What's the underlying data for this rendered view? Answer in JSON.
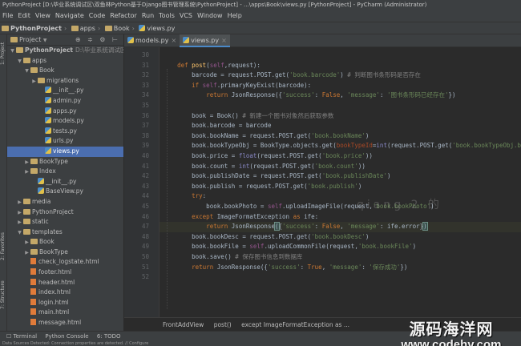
{
  "window": {
    "title": "PythonProject [D:\\毕业系统调试区\\双鱼林Python基于Django图书管理系统\\PythonProject] - ...\\apps\\Book\\views.py [PythonProject] - PyCharm (Administrator)"
  },
  "menu": [
    "File",
    "Edit",
    "View",
    "Navigate",
    "Code",
    "Refactor",
    "Run",
    "Tools",
    "VCS",
    "Window",
    "Help"
  ],
  "breadcrumb": [
    "PythonProject",
    "apps",
    "Book",
    "views.py"
  ],
  "project_panel": {
    "title": "Project",
    "tools": "⊕ ≑ ⚙ ⊢",
    "tree": [
      {
        "label": "PythonProject",
        "extra": "D:\\毕业系统调试区\\",
        "indent": 0,
        "arrow": "▼",
        "icon": "folder",
        "bold": true
      },
      {
        "label": "apps",
        "indent": 1,
        "arrow": "▼",
        "icon": "folder"
      },
      {
        "label": "Book",
        "indent": 2,
        "arrow": "▼",
        "icon": "folder"
      },
      {
        "label": "migrations",
        "indent": 3,
        "arrow": "▶",
        "icon": "folder"
      },
      {
        "label": "__init__.py",
        "indent": 4,
        "arrow": "",
        "icon": "py"
      },
      {
        "label": "admin.py",
        "indent": 4,
        "arrow": "",
        "icon": "py"
      },
      {
        "label": "apps.py",
        "indent": 4,
        "arrow": "",
        "icon": "py"
      },
      {
        "label": "models.py",
        "indent": 4,
        "arrow": "",
        "icon": "py"
      },
      {
        "label": "tests.py",
        "indent": 4,
        "arrow": "",
        "icon": "py"
      },
      {
        "label": "urls.py",
        "indent": 4,
        "arrow": "",
        "icon": "py"
      },
      {
        "label": "views.py",
        "indent": 4,
        "arrow": "",
        "icon": "py",
        "selected": true
      },
      {
        "label": "BookType",
        "indent": 2,
        "arrow": "▶",
        "icon": "folder"
      },
      {
        "label": "Index",
        "indent": 2,
        "arrow": "▶",
        "icon": "folder"
      },
      {
        "label": "__init__.py",
        "indent": 3,
        "arrow": "",
        "icon": "py"
      },
      {
        "label": "BaseView.py",
        "indent": 3,
        "arrow": "",
        "icon": "py"
      },
      {
        "label": "media",
        "indent": 1,
        "arrow": "▶",
        "icon": "folder"
      },
      {
        "label": "PythonProject",
        "indent": 1,
        "arrow": "▶",
        "icon": "folder"
      },
      {
        "label": "static",
        "indent": 1,
        "arrow": "▶",
        "icon": "folder"
      },
      {
        "label": "templates",
        "indent": 1,
        "arrow": "▼",
        "icon": "folder"
      },
      {
        "label": "Book",
        "indent": 2,
        "arrow": "▶",
        "icon": "folder"
      },
      {
        "label": "BookType",
        "indent": 2,
        "arrow": "▶",
        "icon": "folder"
      },
      {
        "label": "check_logstate.html",
        "indent": 2,
        "arrow": "",
        "icon": "html"
      },
      {
        "label": "footer.html",
        "indent": 2,
        "arrow": "",
        "icon": "html"
      },
      {
        "label": "header.html",
        "indent": 2,
        "arrow": "",
        "icon": "html"
      },
      {
        "label": "index.html",
        "indent": 2,
        "arrow": "",
        "icon": "html"
      },
      {
        "label": "login.html",
        "indent": 2,
        "arrow": "",
        "icon": "html"
      },
      {
        "label": "main.html",
        "indent": 2,
        "arrow": "",
        "icon": "html"
      },
      {
        "label": "message.html",
        "indent": 2,
        "arrow": "",
        "icon": "html"
      }
    ]
  },
  "side_tabs": {
    "project": "1: Project",
    "favorites": "2: Favorites",
    "structure": "7: Structure"
  },
  "tabs": [
    {
      "label": "models.py",
      "active": false
    },
    {
      "label": "views.py",
      "active": true
    }
  ],
  "code_lines": [
    {
      "n": "30",
      "html": ""
    },
    {
      "n": "31",
      "html": "    <span class=\"kw\">def</span> <span class=\"fn\">post</span>(<span class=\"sf\">self</span>,request):"
    },
    {
      "n": "32",
      "html": "        barcode = request.POST.get(<span class=\"st\">'book.barcode'</span>)<span class=\"cm\"> # 判断图书条形码是否存在</span>"
    },
    {
      "n": "33",
      "html": "        <span class=\"kw\">if</span> <span class=\"sf\">self</span>.primaryKeyExist(barcode):"
    },
    {
      "n": "34",
      "html": "            <span class=\"kw\">return</span> JsonResponse({<span class=\"st\">'success'</span>: <span class=\"kw\">False</span>, <span class=\"st\">'message'</span>: <span class=\"st\">'图书条形码已经存在'</span>})"
    },
    {
      "n": "35",
      "html": ""
    },
    {
      "n": "36",
      "html": "        book = Book()<span class=\"cm\"> # 新建一个图书对象然后获取参数</span>"
    },
    {
      "n": "37",
      "html": "        book.barcode = barcode"
    },
    {
      "n": "38",
      "html": "        book.bookName = request.POST.get(<span class=\"st\">'book.bookName'</span>)"
    },
    {
      "n": "39",
      "html": "        book.bookTypeObj = BookType.objects.get(<span class=\"pr\">bookTypeId</span>=<span class=\"bi\">int</span>(request.POST.get(<span class=\"st\">'book.bookTypeObj.bookTypeId'</span>)))"
    },
    {
      "n": "40",
      "html": "        book.price = <span class=\"bi\">float</span>(request.POST.get(<span class=\"st\">'book.price'</span>))"
    },
    {
      "n": "41",
      "html": "        book.count = <span class=\"bi\">int</span>(request.POST.get(<span class=\"st\">'book.count'</span>))"
    },
    {
      "n": "42",
      "html": "        book.publishDate = request.POST.get(<span class=\"st\">'book.publishDate'</span>)"
    },
    {
      "n": "43",
      "html": "        book.publish = request.POST.get(<span class=\"st\">'book.publish'</span>)"
    },
    {
      "n": "44",
      "html": "        <span class=\"kw\">try</span>:"
    },
    {
      "n": "45",
      "html": "            book.bookPhoto = <span class=\"sf\">self</span>.uploadImageFile(request,<span class=\"st\">'book.bookPhoto'</span>)"
    },
    {
      "n": "46",
      "html": "        <span class=\"kw\">except</span> ImageFormatException <span class=\"kw\">as</span> ife:"
    },
    {
      "n": "47",
      "html": "            <span class=\"kw\">return</span> JsonResponse<span class=\"brk\">(</span>{<span class=\"st\">'success'</span>: <span class=\"kw\">False</span>, <span class=\"st\">'message'</span>: ife.error}<span class=\"brk\">)</span>",
      "hl": true
    },
    {
      "n": "48",
      "html": "        book.bookDesc = request.POST.get(<span class=\"st\">'book.bookDesc'</span>)"
    },
    {
      "n": "49",
      "html": "        book.bookFile = <span class=\"sf\">self</span>.uploadCommonFile(request,<span class=\"st\">'book.bookFile'</span>)"
    },
    {
      "n": "50",
      "html": "        book.save()<span class=\"cm\"> # 保存图书信息到数据库</span>"
    },
    {
      "n": "51",
      "html": "        <span class=\"kw\">return</span> JsonResponse({<span class=\"st\">'success'</span>: <span class=\"kw\">True</span>, <span class=\"st\">'message'</span>: <span class=\"st\">'保存成功'</span>})"
    },
    {
      "n": "52",
      "html": ""
    }
  ],
  "editor_breadcrumb": [
    "FrontAddView",
    "post()",
    "except ImageFormatException as ..."
  ],
  "toolwindows": [
    "☐ Terminal",
    "Python Console",
    "6: TODO"
  ],
  "status_text": "Data Sources Detected: Connection properties are detected. // Configure",
  "watermark": {
    "line1": "源码海洋网",
    "line2": "www.codehy.com"
  },
  "blur_watermark": "qiang 2 的"
}
